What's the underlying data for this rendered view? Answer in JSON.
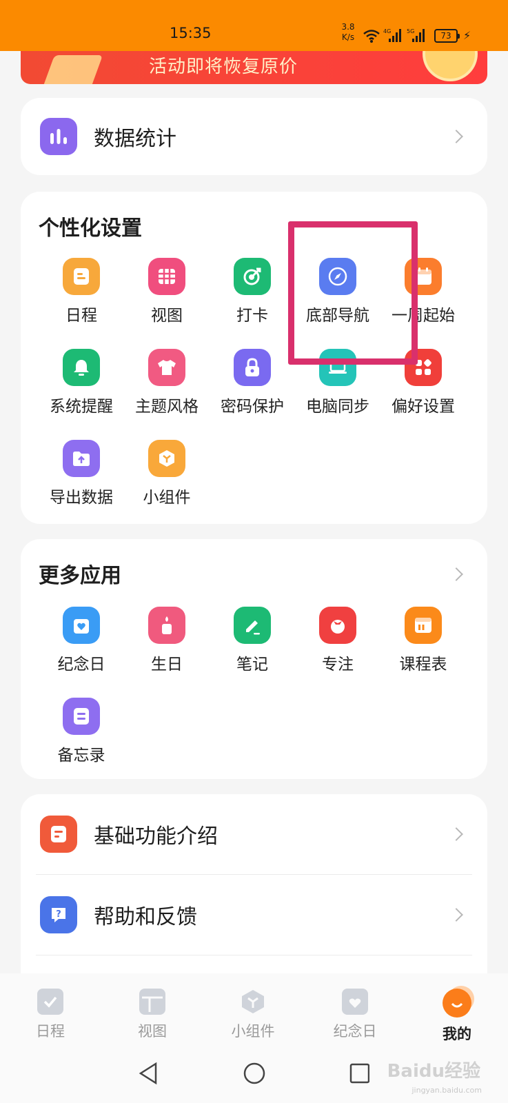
{
  "status_bar": {
    "time": "15:35",
    "net_speed_value": "3.8",
    "net_speed_unit": "K/s",
    "battery": "73"
  },
  "promo": {
    "text": "活动即将恢复原价"
  },
  "stats": {
    "label": "数据统计"
  },
  "personalization": {
    "title": "个性化设置",
    "items": [
      {
        "label": "日程",
        "icon": "schedule-icon",
        "color": "#f7a83b"
      },
      {
        "label": "视图",
        "icon": "grid-view-icon",
        "color": "#f04e7e"
      },
      {
        "label": "打卡",
        "icon": "target-icon",
        "color": "#1dba74"
      },
      {
        "label": "底部导航",
        "icon": "compass-icon",
        "color": "#5a7cf0"
      },
      {
        "label": "一周起始",
        "icon": "calendar-icon",
        "color": "#fb7d2d"
      },
      {
        "label": "系统提醒",
        "icon": "bell-icon",
        "color": "#1dba74"
      },
      {
        "label": "主题风格",
        "icon": "shirt-icon",
        "color": "#f15a82"
      },
      {
        "label": "密码保护",
        "icon": "lock-icon",
        "color": "#7a6af0"
      },
      {
        "label": "电脑同步",
        "icon": "laptop-icon",
        "color": "#24c4b8"
      },
      {
        "label": "偏好设置",
        "icon": "apps-icon",
        "color": "#f03f3a"
      },
      {
        "label": "导出数据",
        "icon": "export-folder-icon",
        "color": "#8e6ef0"
      },
      {
        "label": "小组件",
        "icon": "widget-cube-icon",
        "color": "#f9a83a"
      }
    ]
  },
  "more_apps": {
    "title": "更多应用",
    "items": [
      {
        "label": "纪念日",
        "icon": "anniversary-icon",
        "color": "#3a9cf5"
      },
      {
        "label": "生日",
        "icon": "cake-icon",
        "color": "#f05a7e"
      },
      {
        "label": "笔记",
        "icon": "pencil-icon",
        "color": "#1dba74"
      },
      {
        "label": "专注",
        "icon": "tomato-icon",
        "color": "#f04040"
      },
      {
        "label": "课程表",
        "icon": "timetable-icon",
        "color": "#fb8a1a"
      },
      {
        "label": "备忘录",
        "icon": "memo-icon",
        "color": "#8e6ef0"
      }
    ]
  },
  "links": [
    {
      "label": "基础功能介绍",
      "icon": "intro-doc-icon",
      "color": "#f05a3a"
    },
    {
      "label": "帮助和反馈",
      "icon": "help-icon",
      "color": "#4a74e8"
    }
  ],
  "bottom_nav": [
    {
      "label": "日程",
      "icon": "check-square-icon"
    },
    {
      "label": "视图",
      "icon": "layout-icon"
    },
    {
      "label": "小组件",
      "icon": "cube-icon"
    },
    {
      "label": "纪念日",
      "icon": "calendar-heart-icon"
    },
    {
      "label": "我的",
      "icon": "profile-smile-icon",
      "active": true
    }
  ],
  "watermark": {
    "text": "Baidu经验",
    "sub": "jingyan.baidu.com"
  }
}
